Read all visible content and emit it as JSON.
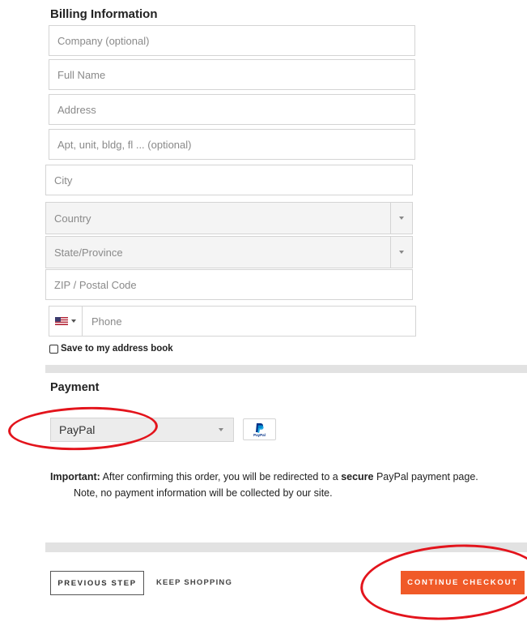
{
  "billing": {
    "heading": "Billing Information",
    "company_placeholder": "Company  (optional)",
    "fullname_placeholder": "Full Name",
    "address_placeholder": "Address",
    "apt_placeholder": "Apt, unit, bldg, fl ...  (optional)",
    "city_placeholder": "City",
    "country_placeholder": "Country",
    "state_placeholder": "State/Province",
    "zip_placeholder": "ZIP / Postal Code",
    "phone_placeholder": "Phone",
    "phone_flag": "us-flag-icon",
    "save_label": "Save to my address book",
    "save_checked": false
  },
  "payment": {
    "heading": "Payment",
    "method_selected": "PayPal",
    "method_icon": "paypal-logo",
    "important_label": "Important:",
    "message_part1": " After confirming this order, you will be redirected to a ",
    "message_bold": "secure",
    "message_part2": " PayPal payment page.",
    "message_line2": "Note, no payment information will be collected by our site.",
    "paypal_text": "PayPal"
  },
  "footer": {
    "previous_label": "PREVIOUS STEP",
    "keep_shopping_label": "KEEP SHOPPING",
    "continue_label": "CONTINUE CHECKOUT"
  },
  "colors": {
    "accent": "#f05a28",
    "annotation": "#e3141c"
  }
}
